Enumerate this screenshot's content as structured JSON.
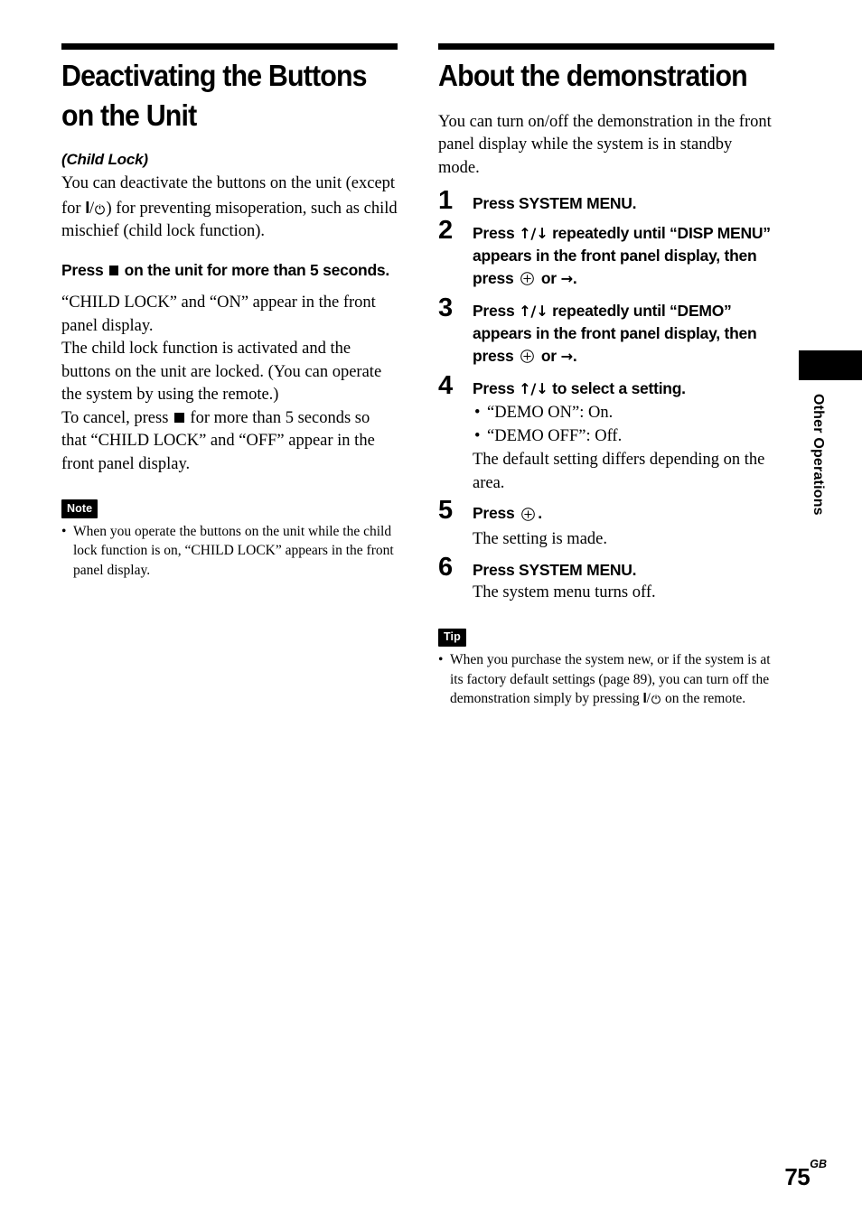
{
  "page": {
    "number": "75",
    "region_code": "GB",
    "side_tab_label": "Other Operations"
  },
  "left_column": {
    "heading": "Deactivating the Buttons on the Unit",
    "subtitle": "(Child Lock)",
    "intro_part1": "You can deactivate the buttons on the unit (except for ",
    "intro_part2": ") for preventing misoperation, such as child mischief (child lock function).",
    "instruction_part1": "Press ",
    "instruction_part2": " on the unit for more than 5 seconds.",
    "result_1": "“CHILD LOCK” and “ON” appear in the front panel display.",
    "result_2": "The child lock function is activated and the buttons on the unit are locked. (You can operate the system by using the remote.)",
    "result_3_part1": "To cancel, press ",
    "result_3_part2": " for more than 5 seconds so that “CHILD LOCK” and “OFF” appear in the front panel display.",
    "note": {
      "badge": "Note",
      "items": [
        "When you operate the buttons on the unit while the child lock function is on, “CHILD LOCK” appears in the front panel display."
      ]
    }
  },
  "right_column": {
    "heading": "About the demonstration",
    "intro": "You can turn on/off the demonstration in the front panel display while the system is in standby mode.",
    "steps": [
      {
        "num": "1",
        "title": "Press SYSTEM MENU.",
        "title_pre": "Press SYSTEM MENU.",
        "title_post": "",
        "desc": ""
      },
      {
        "num": "2",
        "title_pre": "Press ",
        "title_mid": " repeatedly until “DISP MENU” appears in the front panel display, then press ",
        "title_post": " or ",
        "title_end": ".",
        "desc": ""
      },
      {
        "num": "3",
        "title_pre": "Press ",
        "title_mid": " repeatedly until “DEMO” appears in the front panel display, then press ",
        "title_post": " or ",
        "title_end": ".",
        "desc": ""
      },
      {
        "num": "4",
        "title_pre": "Press ",
        "title_mid": " to select a setting.",
        "bullets": [
          "“DEMO ON”: On.",
          "“DEMO OFF”: Off."
        ],
        "desc": "The default setting differs depending on the area."
      },
      {
        "num": "5",
        "title_pre": "Press ",
        "title_end": ".",
        "desc": "The setting is made."
      },
      {
        "num": "6",
        "title_pre": "Press SYSTEM MENU.",
        "desc": "The system menu turns off."
      }
    ],
    "tip": {
      "badge": "Tip",
      "item_part1": "When you purchase the system new, or if the system is at its factory default settings (page 89), you can turn off the demonstration simply by pressing ",
      "item_part2": " on the remote."
    }
  },
  "glyphs": {
    "power": "I/⏻",
    "stop_square": "■",
    "up_down": "↑/↓",
    "enter": "⊕",
    "right_arrow": "→"
  },
  "colors": {
    "text": "#000000",
    "background": "#ffffff",
    "badge_background": "#000000",
    "badge_text": "#ffffff"
  }
}
